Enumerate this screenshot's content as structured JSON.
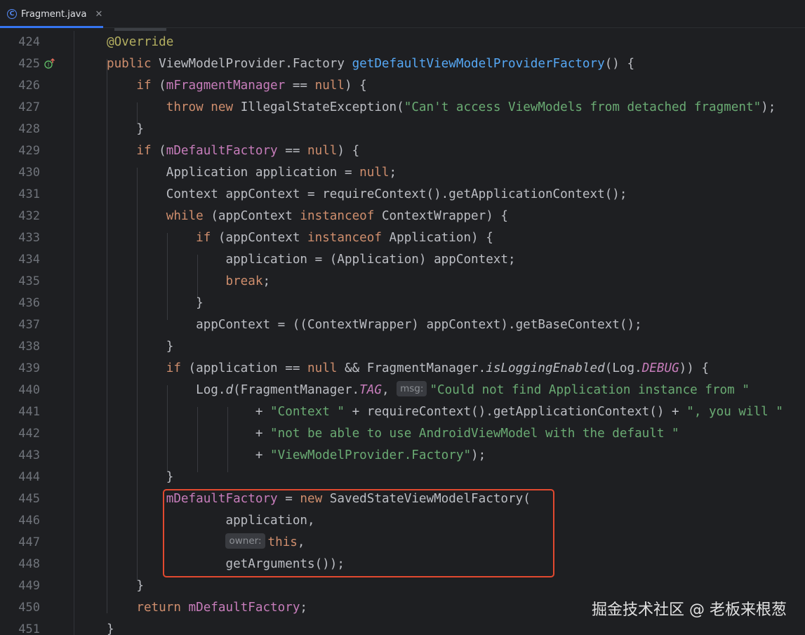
{
  "tab": {
    "filename": "Fragment.java",
    "icon": "class-icon",
    "icon_letter": "C",
    "close_glyph": "✕",
    "active": true
  },
  "colors": {
    "keyword": "#cf8e6d",
    "method": "#56a8f5",
    "field": "#c77dbb",
    "string": "#6aab73",
    "annotation": "#b3ae60",
    "highlight_border": "#e2492f"
  },
  "editor": {
    "gutter_icon": "implementing-method-up-arrow-icon",
    "lines": [
      {
        "n": "424",
        "indent": "",
        "tokens": [
          {
            "t": "@Override",
            "c": "ann"
          }
        ]
      },
      {
        "n": "425",
        "indent": "",
        "tokens": [
          {
            "t": "public ",
            "c": "kw"
          },
          {
            "t": "ViewModelProvider.Factory "
          },
          {
            "t": "getDefaultViewModelProviderFactory",
            "c": "fn"
          },
          {
            "t": "() {"
          }
        ]
      },
      {
        "n": "426",
        "indent": "    ",
        "tokens": [
          {
            "t": "if ",
            "c": "kw"
          },
          {
            "t": "("
          },
          {
            "t": "mFragmentManager",
            "c": "fld"
          },
          {
            "t": " == "
          },
          {
            "t": "null",
            "c": "kw"
          },
          {
            "t": ") {"
          }
        ]
      },
      {
        "n": "427",
        "indent": "        ",
        "tokens": [
          {
            "t": "throw new ",
            "c": "kw"
          },
          {
            "t": "IllegalStateException("
          },
          {
            "t": "\"Can't access ViewModels from detached fragment\"",
            "c": "str"
          },
          {
            "t": ");"
          }
        ]
      },
      {
        "n": "428",
        "indent": "    ",
        "tokens": [
          {
            "t": "}"
          }
        ]
      },
      {
        "n": "429",
        "indent": "    ",
        "tokens": [
          {
            "t": "if ",
            "c": "kw"
          },
          {
            "t": "("
          },
          {
            "t": "mDefaultFactory",
            "c": "fld"
          },
          {
            "t": " == "
          },
          {
            "t": "null",
            "c": "kw"
          },
          {
            "t": ") {"
          }
        ]
      },
      {
        "n": "430",
        "indent": "        ",
        "tokens": [
          {
            "t": "Application application = "
          },
          {
            "t": "null",
            "c": "kw"
          },
          {
            "t": ";"
          }
        ]
      },
      {
        "n": "431",
        "indent": "        ",
        "tokens": [
          {
            "t": "Context appContext = requireContext().getApplicationContext();"
          }
        ]
      },
      {
        "n": "432",
        "indent": "        ",
        "tokens": [
          {
            "t": "while ",
            "c": "kw"
          },
          {
            "t": "(appContext "
          },
          {
            "t": "instanceof ",
            "c": "kw"
          },
          {
            "t": "ContextWrapper) {"
          }
        ]
      },
      {
        "n": "433",
        "indent": "            ",
        "tokens": [
          {
            "t": "if ",
            "c": "kw"
          },
          {
            "t": "(appContext "
          },
          {
            "t": "instanceof ",
            "c": "kw"
          },
          {
            "t": "Application) {"
          }
        ]
      },
      {
        "n": "434",
        "indent": "                ",
        "tokens": [
          {
            "t": "application = (Application) appContext;"
          }
        ]
      },
      {
        "n": "435",
        "indent": "                ",
        "tokens": [
          {
            "t": "break",
            "c": "kw"
          },
          {
            "t": ";"
          }
        ]
      },
      {
        "n": "436",
        "indent": "            ",
        "tokens": [
          {
            "t": "}"
          }
        ]
      },
      {
        "n": "437",
        "indent": "            ",
        "tokens": [
          {
            "t": "appContext = ((ContextWrapper) appContext).getBaseContext();"
          }
        ]
      },
      {
        "n": "438",
        "indent": "        ",
        "tokens": [
          {
            "t": "}"
          }
        ]
      },
      {
        "n": "439",
        "indent": "        ",
        "tokens": [
          {
            "t": "if ",
            "c": "kw"
          },
          {
            "t": "(application == "
          },
          {
            "t": "null",
            "c": "kw"
          },
          {
            "t": " && FragmentManager."
          },
          {
            "t": "isLoggingEnabled",
            "c": "ital"
          },
          {
            "t": "(Log."
          },
          {
            "t": "DEBUG",
            "c": "fldi"
          },
          {
            "t": ")) {"
          }
        ]
      },
      {
        "n": "440",
        "indent": "            ",
        "tokens": [
          {
            "t": "Log."
          },
          {
            "t": "d",
            "c": "ital"
          },
          {
            "t": "(FragmentManager."
          },
          {
            "t": "TAG",
            "c": "fldi"
          },
          {
            "t": ", "
          },
          {
            "t": "msg:",
            "c": "hint"
          },
          {
            "t": "\"Could not find Application instance from \"",
            "c": "str"
          }
        ]
      },
      {
        "n": "441",
        "indent": "                    ",
        "tokens": [
          {
            "t": "+ "
          },
          {
            "t": "\"Context \"",
            "c": "str"
          },
          {
            "t": " + requireContext().getApplicationContext() + "
          },
          {
            "t": "\", you will \"",
            "c": "str"
          }
        ]
      },
      {
        "n": "442",
        "indent": "                    ",
        "tokens": [
          {
            "t": "+ "
          },
          {
            "t": "\"not be able to use AndroidViewModel with the default \"",
            "c": "str"
          }
        ]
      },
      {
        "n": "443",
        "indent": "                    ",
        "tokens": [
          {
            "t": "+ "
          },
          {
            "t": "\"ViewModelProvider.Factory\"",
            "c": "str"
          },
          {
            "t": ");"
          }
        ]
      },
      {
        "n": "444",
        "indent": "        ",
        "tokens": [
          {
            "t": "}"
          }
        ]
      },
      {
        "n": "445",
        "indent": "        ",
        "tokens": [
          {
            "t": "mDefaultFactory",
            "c": "fld"
          },
          {
            "t": " = "
          },
          {
            "t": "new ",
            "c": "kw"
          },
          {
            "t": "SavedStateViewModelFactory("
          }
        ]
      },
      {
        "n": "446",
        "indent": "                ",
        "tokens": [
          {
            "t": "application,"
          }
        ]
      },
      {
        "n": "447",
        "indent": "                ",
        "tokens": [
          {
            "t": "owner:",
            "c": "hint"
          },
          {
            "t": "this",
            "c": "kw"
          },
          {
            "t": ","
          }
        ]
      },
      {
        "n": "448",
        "indent": "                ",
        "tokens": [
          {
            "t": "getArguments());"
          }
        ]
      },
      {
        "n": "449",
        "indent": "    ",
        "tokens": [
          {
            "t": "}"
          }
        ]
      },
      {
        "n": "450",
        "indent": "    ",
        "tokens": [
          {
            "t": "return ",
            "c": "kw"
          },
          {
            "t": "mDefaultFactory",
            "c": "fld"
          },
          {
            "t": ";"
          }
        ]
      },
      {
        "n": "451",
        "indent": "",
        "tokens": [
          {
            "t": "}"
          }
        ]
      }
    ]
  },
  "watermark": "掘金技术社区 @ 老板来根葱"
}
